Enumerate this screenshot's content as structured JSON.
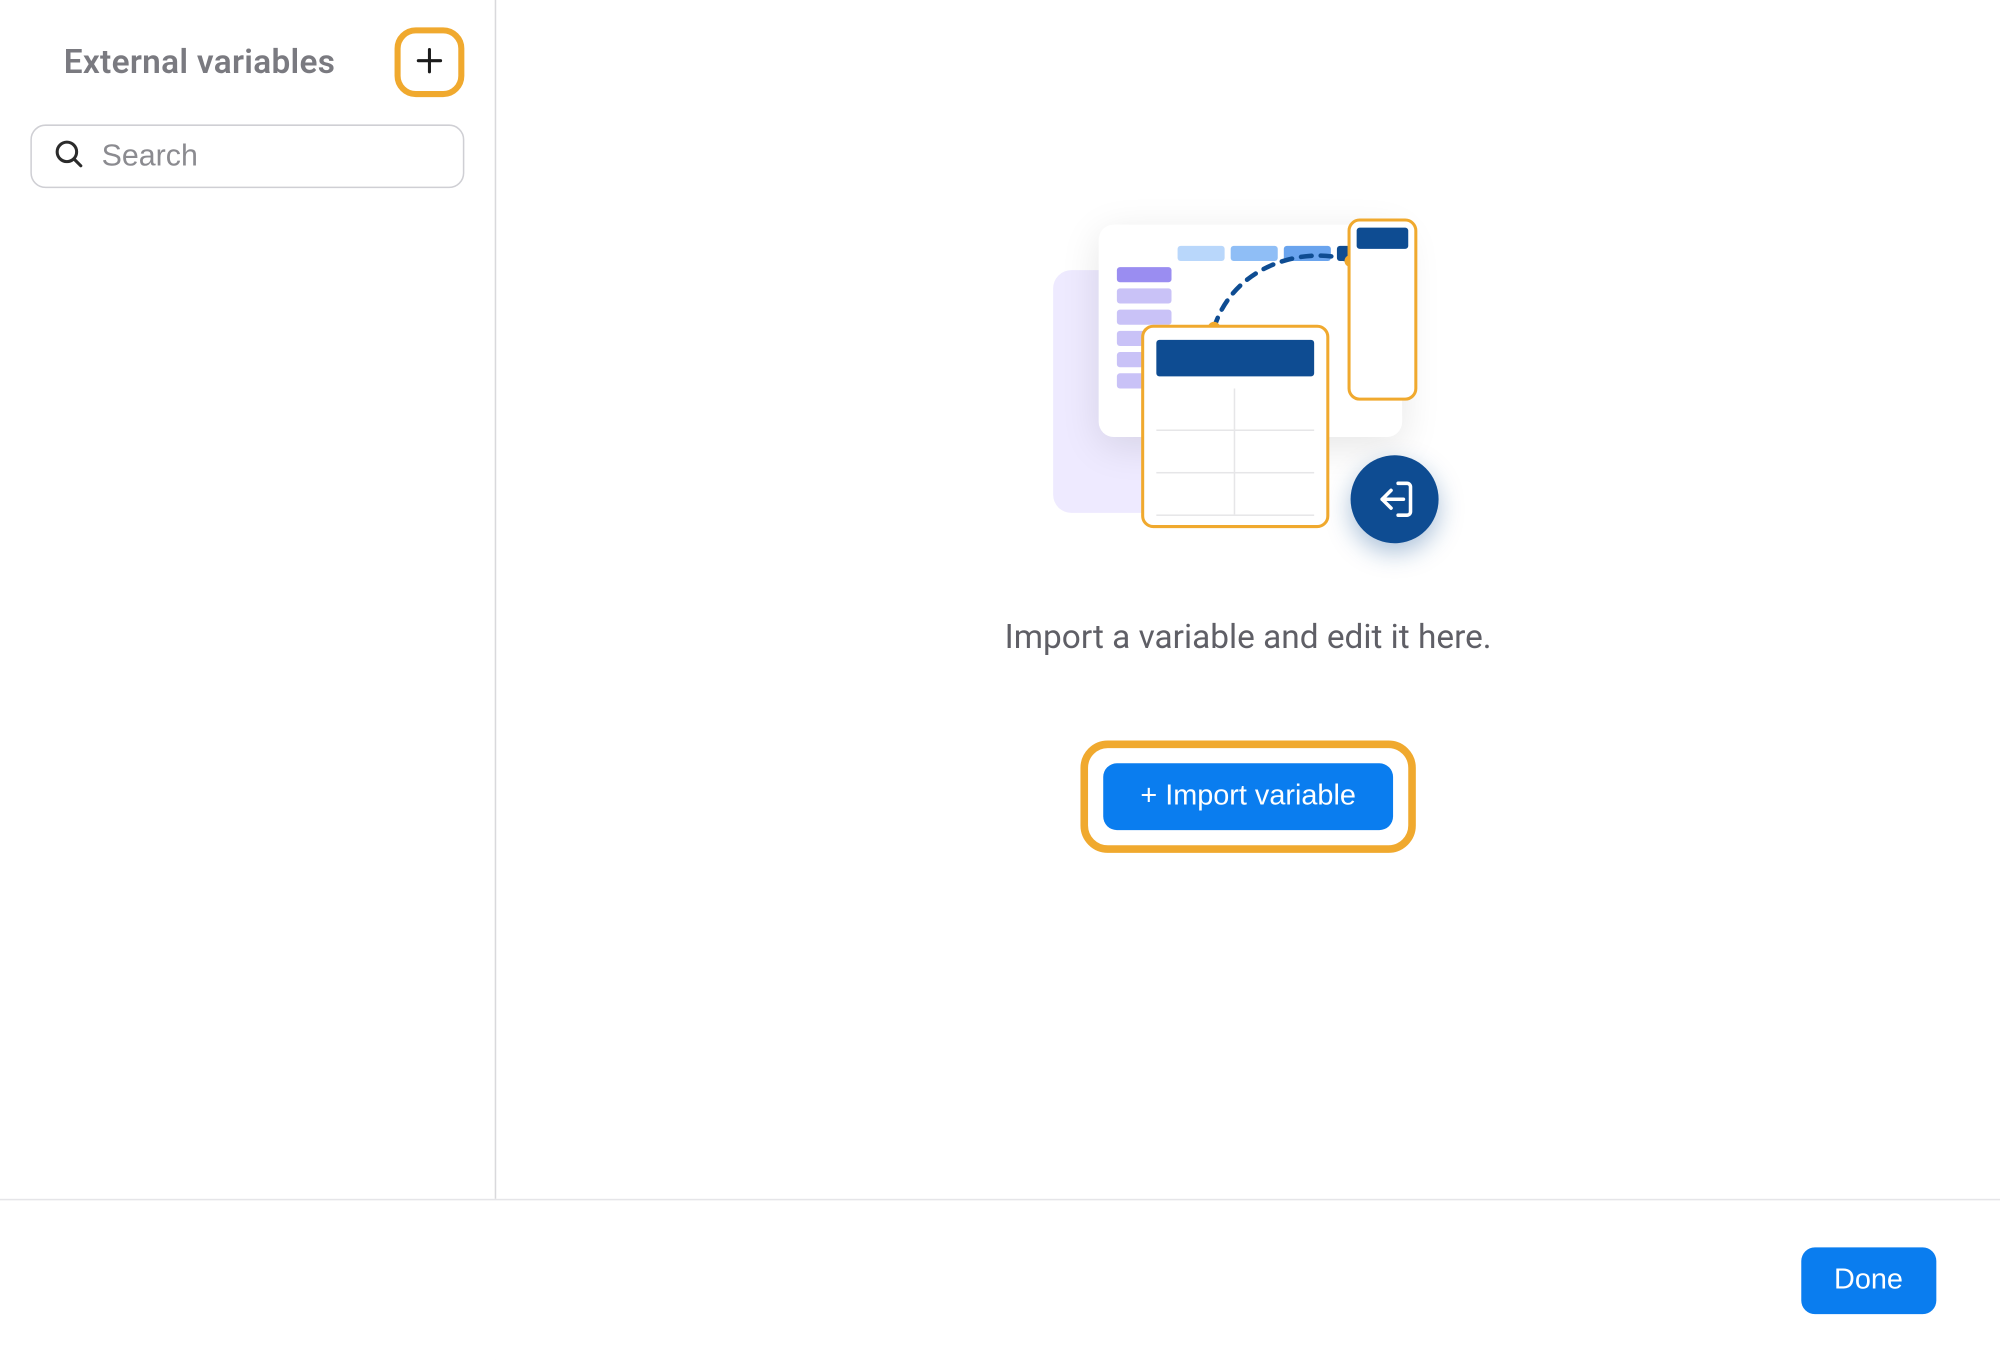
{
  "sidebar": {
    "title": "External variables",
    "search_placeholder": "Search"
  },
  "main": {
    "empty_message": "Import a variable and edit it here.",
    "import_button_label": "+ Import variable"
  },
  "footer": {
    "done_label": "Done"
  },
  "colors": {
    "accent_blue": "#0a7def",
    "highlight_orange": "#f0a92e",
    "dark_navy": "#0e4c92"
  }
}
